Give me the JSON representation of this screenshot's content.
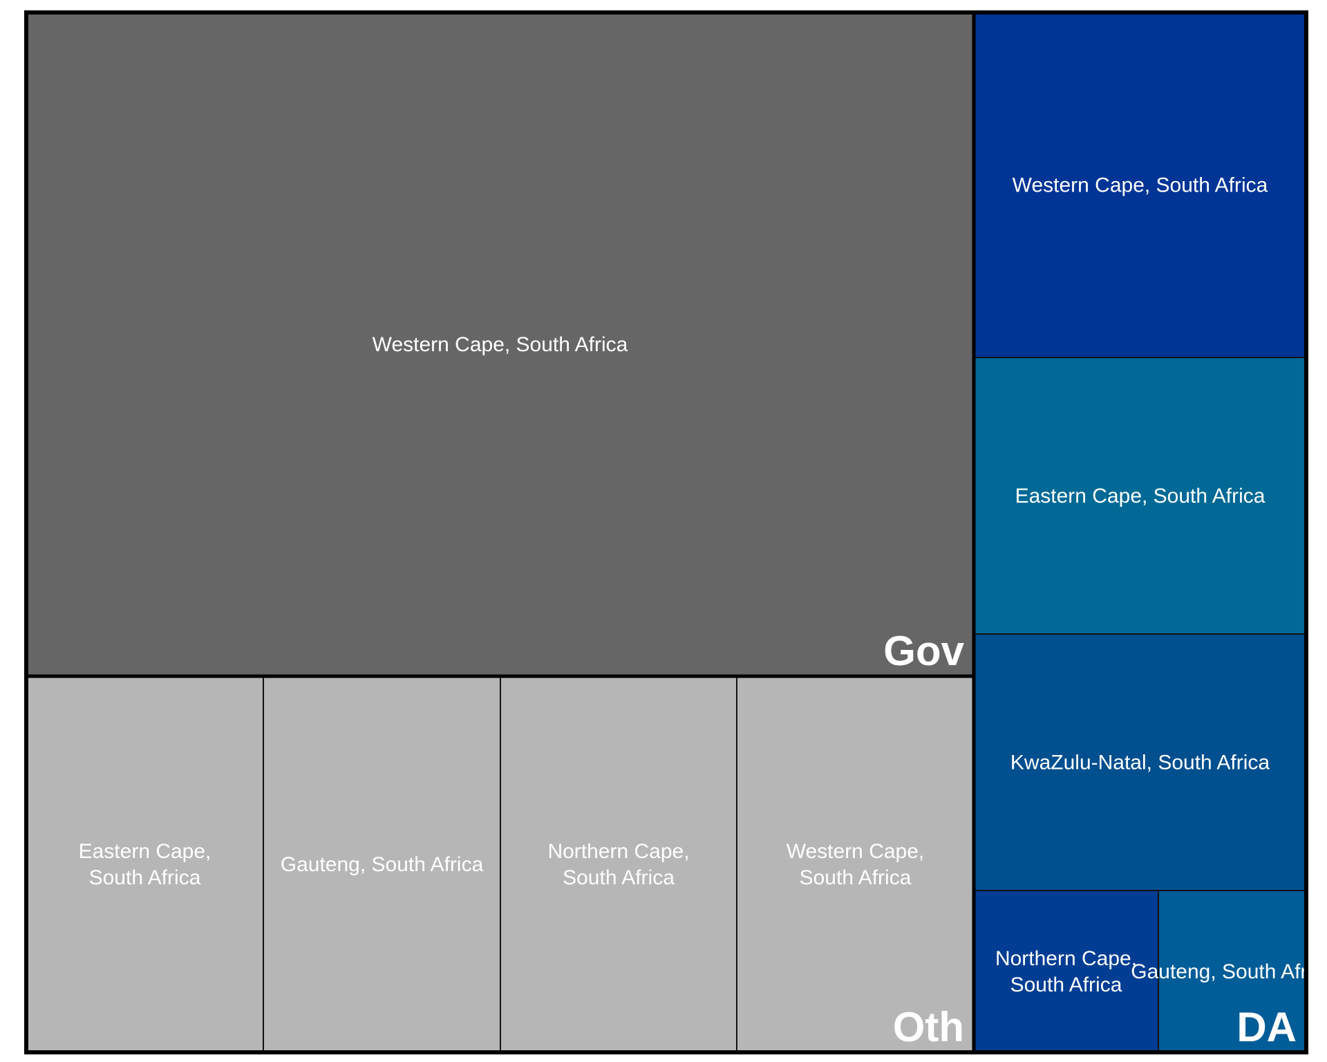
{
  "chart_data": {
    "type": "treemap",
    "title": "",
    "groups": [
      {
        "name": "Gov",
        "color": "#666666",
        "tiles": [
          {
            "label": "Western Cape, South Africa",
            "color": "#666666"
          }
        ]
      },
      {
        "name": "Oth",
        "color": "#b6b6b6",
        "tiles": [
          {
            "label": "Eastern Cape, South Africa",
            "color": "#b6b6b6"
          },
          {
            "label": "Gauteng, South Africa",
            "color": "#b6b6b6"
          },
          {
            "label": "Northern Cape, South Africa",
            "color": "#b6b6b6"
          },
          {
            "label": "Western Cape, South Africa",
            "color": "#b6b6b6"
          }
        ]
      },
      {
        "name": "DA",
        "color": "#003595",
        "tiles": [
          {
            "label": "Western Cape, South Africa",
            "color": "#003595"
          },
          {
            "label": "Eastern Cape, South Africa",
            "color": "#006995"
          },
          {
            "label": "KwaZulu-Natal, South Africa",
            "color": "#004f8f"
          },
          {
            "label": "Northern Cape, South Africa",
            "color": "#003d93"
          },
          {
            "label": "Gauteng, South Africa",
            "color": "#005d97"
          }
        ]
      }
    ]
  }
}
